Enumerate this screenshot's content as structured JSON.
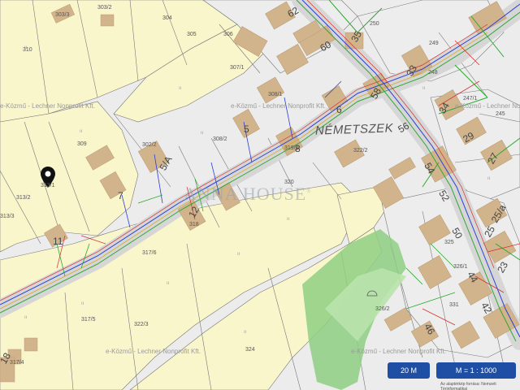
{
  "map": {
    "street_name": "NÉMETSZEK",
    "brand_logo": "ANNA HOUSE",
    "brand_mark": "®",
    "watermark": "e-Közmű - Lechner Nonprofit Kft.",
    "scale_bar_label": "20 M",
    "zoom_label": "M = 1 : 1000",
    "attribution": "Az alaptérkép forrása: Nemzeti Térinformatikai",
    "parcel_labels": [
      {
        "name": "parcel-303-3",
        "text": "303/3"
      },
      {
        "name": "parcel-303-2",
        "text": "303/2"
      },
      {
        "name": "parcel-304",
        "text": "304"
      },
      {
        "name": "parcel-305",
        "text": "305"
      },
      {
        "name": "parcel-306",
        "text": "306"
      },
      {
        "name": "parcel-307-1",
        "text": "307/1"
      },
      {
        "name": "parcel-308-1",
        "text": "308/1"
      },
      {
        "name": "parcel-308-2",
        "text": "308/2"
      },
      {
        "name": "parcel-309",
        "text": "309"
      },
      {
        "name": "parcel-310",
        "text": "310"
      },
      {
        "name": "parcel-302-2",
        "text": "302/2"
      },
      {
        "name": "parcel-313-1",
        "text": "313/1"
      },
      {
        "name": "parcel-313-2",
        "text": "313/2"
      },
      {
        "name": "parcel-313-3",
        "text": "313/3"
      },
      {
        "name": "parcel-318",
        "text": "318"
      },
      {
        "name": "parcel-317-6",
        "text": "317/6"
      },
      {
        "name": "parcel-317-5",
        "text": "317/5"
      },
      {
        "name": "parcel-317-4",
        "text": "317/4"
      },
      {
        "name": "parcel-322-3",
        "text": "322/3"
      },
      {
        "name": "parcel-322-2",
        "text": "322/2"
      },
      {
        "name": "parcel-320",
        "text": "320"
      },
      {
        "name": "parcel-319-2",
        "text": "319/2"
      },
      {
        "name": "parcel-324",
        "text": "324"
      },
      {
        "name": "parcel-326-2",
        "text": "326/2"
      },
      {
        "name": "parcel-325",
        "text": "325"
      },
      {
        "name": "parcel-331",
        "text": "331"
      },
      {
        "name": "parcel-326-1",
        "text": "326/1"
      },
      {
        "name": "parcel-250",
        "text": "250"
      },
      {
        "name": "parcel-249",
        "text": "249"
      },
      {
        "name": "parcel-248",
        "text": "248"
      },
      {
        "name": "parcel-247-1",
        "text": "247/1"
      },
      {
        "name": "parcel-245",
        "text": "245"
      }
    ],
    "house_numbers": [
      {
        "name": "house-number-62",
        "text": "62"
      },
      {
        "name": "house-number-60",
        "text": "60"
      },
      {
        "name": "house-number-35",
        "text": "35"
      },
      {
        "name": "house-number-33",
        "text": "33"
      },
      {
        "name": "house-number-58",
        "text": "58"
      },
      {
        "name": "house-number-6",
        "text": "6"
      },
      {
        "name": "house-number-5",
        "text": "5"
      },
      {
        "name": "house-number-8",
        "text": "8"
      },
      {
        "name": "house-number-56",
        "text": "56"
      },
      {
        "name": "house-number-34",
        "text": "34"
      },
      {
        "name": "house-number-29",
        "text": "29"
      },
      {
        "name": "house-number-27",
        "text": "27"
      },
      {
        "name": "house-number-54",
        "text": "54"
      },
      {
        "name": "house-number-52",
        "text": "52"
      },
      {
        "name": "house-number-5-a",
        "text": "5/A"
      },
      {
        "name": "house-number-7",
        "text": "7"
      },
      {
        "name": "house-number-12",
        "text": "12"
      },
      {
        "name": "house-number-11",
        "text": "11"
      },
      {
        "name": "house-number-50",
        "text": "50"
      },
      {
        "name": "house-number-25-a",
        "text": "25/a"
      },
      {
        "name": "house-number-25",
        "text": "25"
      },
      {
        "name": "house-number-23",
        "text": "23"
      },
      {
        "name": "house-number-44",
        "text": "44"
      },
      {
        "name": "house-number-42",
        "text": "42"
      },
      {
        "name": "house-number-46",
        "text": "46"
      },
      {
        "name": "house-number-18",
        "text": "18"
      }
    ],
    "colors": {
      "parcel_yellow": "#faf6cc",
      "background_grey": "#ececec",
      "building": "#d2b48c",
      "road": "#d6d6d6",
      "green_area": "#8fcf82",
      "utility_blue": "#2b3fd6",
      "utility_green": "#2ea82e",
      "utility_red": "#d33030",
      "button_blue": "#1f4fa4"
    }
  }
}
